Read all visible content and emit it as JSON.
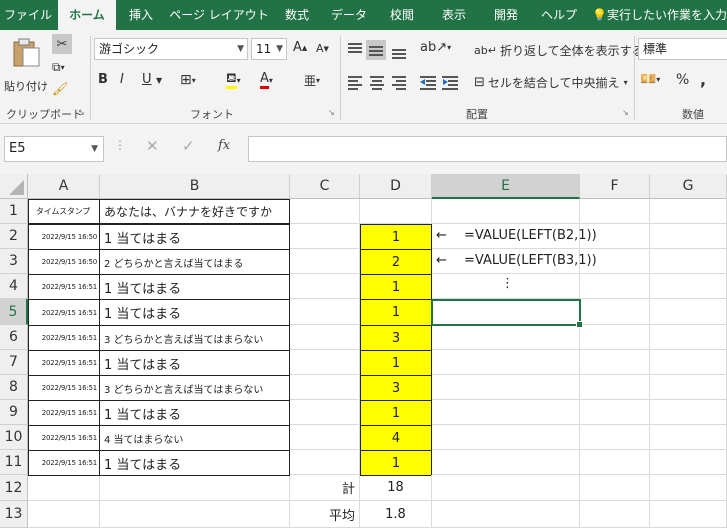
{
  "ribbon_tabs": [
    "ファイル",
    "ホーム",
    "挿入",
    "ページ レイアウト",
    "数式",
    "データ",
    "校閲",
    "表示",
    "開発",
    "ヘルプ"
  ],
  "active_tab": "ホーム",
  "tell_me": "実行したい作業を入力",
  "clipboard": {
    "paste_label": "貼り付け",
    "group_label": "クリップボード"
  },
  "font": {
    "name": "游ゴシック",
    "size": "11",
    "group_label": "フォント",
    "bold": "B",
    "italic": "I",
    "underline": "U",
    "grow": "A",
    "shrink": "A"
  },
  "alignment": {
    "wrap_text": "折り返して全体を表示する",
    "merge_center": "セルを結合して中央揃え",
    "group_label": "配置"
  },
  "number": {
    "format": "標準",
    "group_label": "数値",
    "percent": "%",
    "comma": ","
  },
  "formula_bar": {
    "name_box": "E5",
    "fx": "fx",
    "formula": ""
  },
  "columns": [
    "A",
    "B",
    "C",
    "D",
    "E",
    "F",
    "G"
  ],
  "selected_column": "E",
  "selected_row": "5",
  "rows": [
    "1",
    "2",
    "3",
    "4",
    "5",
    "6",
    "7",
    "8",
    "9",
    "10",
    "11",
    "12",
    "13"
  ],
  "header": {
    "timestamp": "タイムスタンプ",
    "question": "あなたは、バナナを好きですか"
  },
  "records": [
    {
      "timestamp": "2022/9/15 16:50",
      "answer": "1 当てはまる",
      "value": "1"
    },
    {
      "timestamp": "2022/9/15 16:50",
      "answer": "2 どちらかと言えば当てはまる",
      "value": "2"
    },
    {
      "timestamp": "2022/9/15 16:51",
      "answer": "1 当てはまる",
      "value": "1"
    },
    {
      "timestamp": "2022/9/15 16:51",
      "answer": "1 当てはまる",
      "value": "1"
    },
    {
      "timestamp": "2022/9/15 16:51",
      "answer": "3 どちらかと言えば当てはまらない",
      "value": "3"
    },
    {
      "timestamp": "2022/9/15 16:51",
      "answer": "1 当てはまる",
      "value": "1"
    },
    {
      "timestamp": "2022/9/15 16:51",
      "answer": "3 どちらかと言えば当てはまらない",
      "value": "3"
    },
    {
      "timestamp": "2022/9/15 16:51",
      "answer": "1 当てはまる",
      "value": "1"
    },
    {
      "timestamp": "2022/9/15 16:51",
      "answer": "4 当てはまらない",
      "value": "4"
    },
    {
      "timestamp": "2022/9/15 16:51",
      "answer": "1 当てはまる",
      "value": "1"
    }
  ],
  "notes": {
    "arrow": "←",
    "formula_row2": "=VALUE(LEFT(B2,1))",
    "formula_row3": "=VALUE(LEFT(B3,1))",
    "ellipsis": "⋮"
  },
  "summary": {
    "sum_label": "計",
    "sum_value": "18",
    "avg_label": "平均",
    "avg_value": "1.8"
  },
  "colors": {
    "ribbon_green": "#217346",
    "highlight": "#ffff00"
  }
}
